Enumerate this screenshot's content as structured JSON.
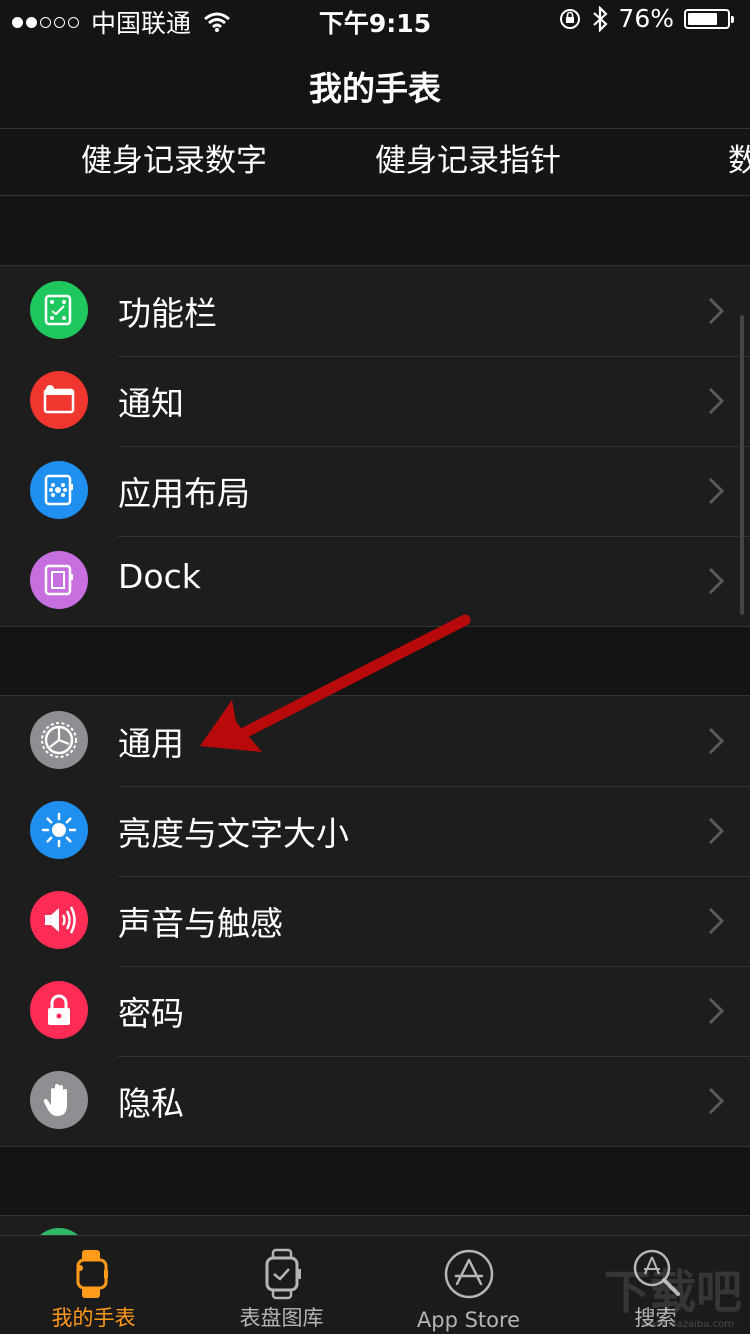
{
  "status_bar": {
    "carrier": "中国联通",
    "time": "下午9:15",
    "battery": "76%",
    "battery_level": 0.76
  },
  "nav": {
    "title": "我的手表"
  },
  "faces": [
    "健身记录数字",
    "健身记录指针",
    "数"
  ],
  "group1": [
    {
      "label": "功能栏",
      "icon": "dock-grid-icon",
      "color": "#1fc75f"
    },
    {
      "label": "通知",
      "icon": "notification-icon",
      "color": "#f0372f"
    },
    {
      "label": "应用布局",
      "icon": "app-layout-icon",
      "color": "#1f8ff0"
    },
    {
      "label": "Dock",
      "icon": "dock-icon",
      "color": "#c86fe0"
    }
  ],
  "group2": [
    {
      "label": "通用",
      "icon": "gear-icon",
      "color": "#8e8e93"
    },
    {
      "label": "亮度与文字大小",
      "icon": "brightness-icon",
      "color": "#1f8ff0"
    },
    {
      "label": "声音与触感",
      "icon": "speaker-icon",
      "color": "#ff2d55"
    },
    {
      "label": "密码",
      "icon": "lock-icon",
      "color": "#ff2d55"
    },
    {
      "label": "隐私",
      "icon": "hand-icon",
      "color": "#8e8e93"
    }
  ],
  "tabs": [
    {
      "label": "我的手表",
      "active": true
    },
    {
      "label": "表盘图库",
      "active": false
    },
    {
      "label": "App Store",
      "active": false
    },
    {
      "label": "搜索",
      "active": false
    }
  ],
  "watermark": {
    "text": "下载吧",
    "sub": "www.xiazaiba.com"
  },
  "colors": {
    "accent": "#ff9a1b",
    "arrow": "#b80a0a"
  }
}
